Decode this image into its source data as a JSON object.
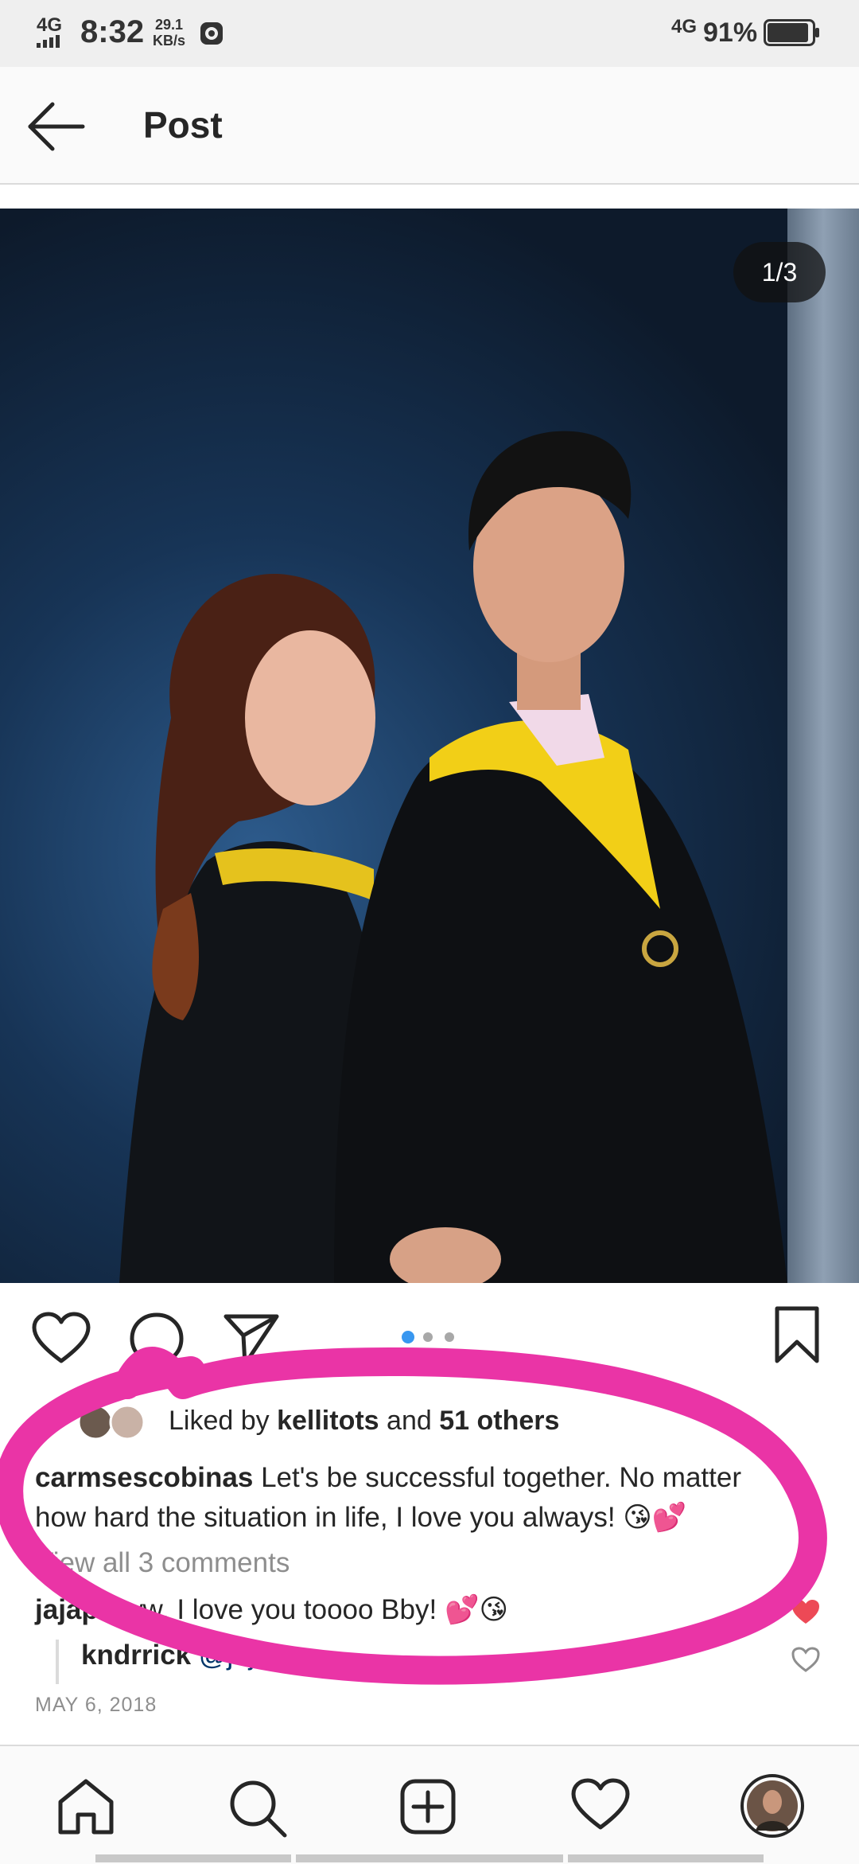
{
  "status_bar": {
    "network": "4G",
    "time": "8:32",
    "speed_value": "29.1",
    "speed_unit": "KB/s",
    "network_right": "4G",
    "battery_percent": "91%",
    "battery_level": 0.91
  },
  "header": {
    "title": "Post",
    "back_icon": "arrow-left-icon"
  },
  "post": {
    "image_counter": "1/3",
    "carousel_active_index": 0,
    "carousel_count": 3,
    "actions": {
      "like_icon": "heart-outline-icon",
      "comment_icon": "comment-bubble-icon",
      "share_icon": "paper-plane-icon",
      "save_icon": "bookmark-icon"
    },
    "likes": {
      "prefix": "Liked by",
      "user": "kellitots",
      "conjunction": "and",
      "others": "51 others"
    },
    "caption": {
      "username": "carmsescobinas",
      "text": "Let's be successful together. No matter how hard the situation in life, I love you always! 😘💕"
    },
    "view_comments": "View all 3 comments",
    "comments": [
      {
        "username": "jajap",
        "text": "Aww. I love you toooo Bby! 💕😘",
        "liked": true
      }
    ],
    "replies": [
      {
        "username": "kndrrick",
        "text": "@jajap",
        "liked": false
      }
    ],
    "date": "MAY 6, 2018"
  },
  "bottom_nav": {
    "items": [
      "home-icon",
      "search-icon",
      "add-post-icon",
      "activity-heart-icon",
      "profile-avatar"
    ]
  },
  "colors": {
    "accent_blue": "#3897f0",
    "like_red": "#ed4956",
    "annotation_pink": "#ea34a6"
  }
}
